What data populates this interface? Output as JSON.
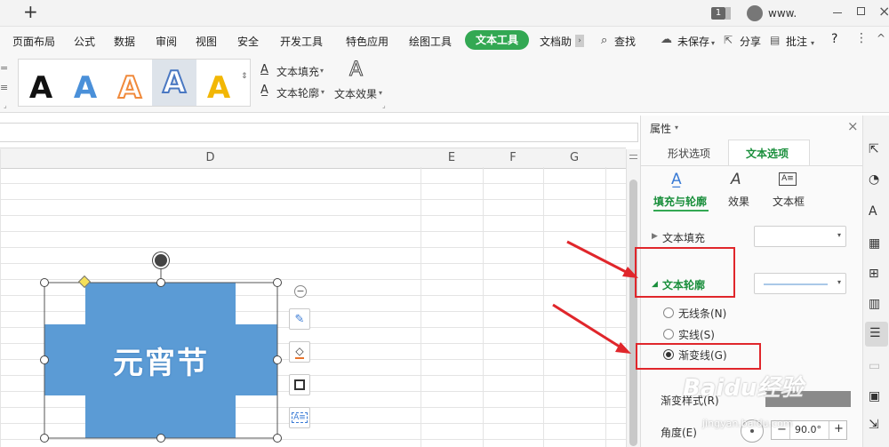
{
  "titlebar": {
    "new_tab_label": "+",
    "badge": "1",
    "user_name": "www."
  },
  "menubar": {
    "items": [
      "页面布局",
      "公式",
      "数据",
      "审阅",
      "视图",
      "安全",
      "开发工具",
      "特色应用",
      "绘图工具"
    ],
    "active": "文本工具",
    "more": "文档助",
    "search": "查找",
    "unsaved": "未保存",
    "share": "分享",
    "comment": "批注",
    "help": "?"
  },
  "ribbon": {
    "style_glyph": "A",
    "text_fill": "文本填充",
    "text_outline": "文本轮廓",
    "text_effect": "文本效果",
    "text_effect_glyph": "A"
  },
  "sheet": {
    "columns": [
      "D",
      "E",
      "F",
      "G"
    ]
  },
  "shape": {
    "text": "元宵节",
    "fill_color": "#5b9bd5"
  },
  "panel": {
    "title": "属性",
    "tabs": [
      "形状选项",
      "文本选项"
    ],
    "active_tab": "文本选项",
    "subtabs": [
      "填充与轮廓",
      "效果",
      "文本框"
    ],
    "active_subtab": "填充与轮廓",
    "section_fill": "文本填充",
    "section_outline": "文本轮廓",
    "radio_options": [
      "无线条(N)",
      "实线(S)",
      "渐变线(G)"
    ],
    "selected_radio": "渐变线(G)",
    "gradient_label": "渐变样式(R)",
    "angle_label": "角度(E)",
    "angle_value": "90.0°",
    "minus": "−",
    "plus": "+"
  },
  "watermark": {
    "main": "Baidu经验",
    "sub": "jingyan.baidu.com"
  },
  "colors": {
    "accent_green": "#33a853",
    "annotation_red": "#e0262b",
    "shape_blue": "#5b9bd5"
  }
}
